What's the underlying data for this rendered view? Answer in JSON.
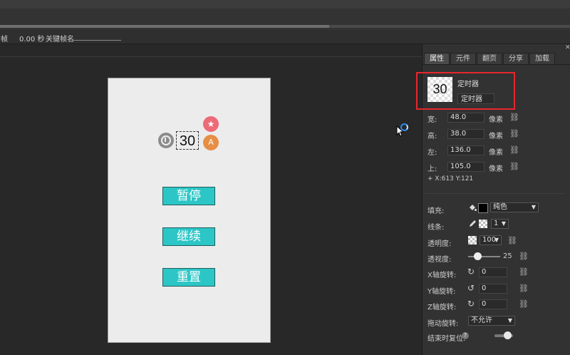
{
  "infobar": {
    "frame_label": "帧",
    "time_value": "0.00 秒",
    "keyframe_name_label": "关键帧名"
  },
  "stage": {
    "timer_value": "30",
    "buttons": {
      "pause": "暂停",
      "continue": "继续",
      "reset": "重置"
    },
    "star_symbol": "★",
    "font_symbol": "A"
  },
  "panel": {
    "close_symbol": "✕",
    "tabs": [
      "属性",
      "元件",
      "翻页",
      "分享",
      "加载"
    ],
    "active_tab": "属性",
    "component": {
      "thumb_text": "30",
      "type": "定时器",
      "name": "定时器"
    },
    "fields": {
      "width": {
        "label": "宽:",
        "value": "48.0",
        "unit": "像素"
      },
      "height": {
        "label": "高:",
        "value": "38.0",
        "unit": "像素"
      },
      "left": {
        "label": "左:",
        "value": "136.0",
        "unit": "像素"
      },
      "top": {
        "label": "上:",
        "value": "105.0",
        "unit": "像素"
      }
    },
    "coords": "+   X:613    Y:121",
    "fill": {
      "label": "填充:",
      "value": "纯色",
      "color": "#000000"
    },
    "stroke": {
      "label": "线条:",
      "value": "1"
    },
    "opacity": {
      "label": "透明度:",
      "value": "100"
    },
    "perspective": {
      "label": "透视度:",
      "value": "25"
    },
    "x_rotate": {
      "label": "X轴旋转:",
      "value": "0"
    },
    "y_rotate": {
      "label": "Y轴旋转:",
      "value": "0"
    },
    "z_rotate": {
      "label": "Z轴旋转:",
      "value": "0"
    },
    "drag_rotate": {
      "label": "拖动旋转:",
      "value": "不允许"
    },
    "reset_on_end": {
      "label": "结束时复位:",
      "help": "?"
    },
    "link_symbol": "⛓"
  },
  "colors": {
    "highlight": "#e8262c",
    "button_teal": "#2dc6c6",
    "star_pink": "#ec6b77",
    "font_orange": "#e78e44"
  }
}
